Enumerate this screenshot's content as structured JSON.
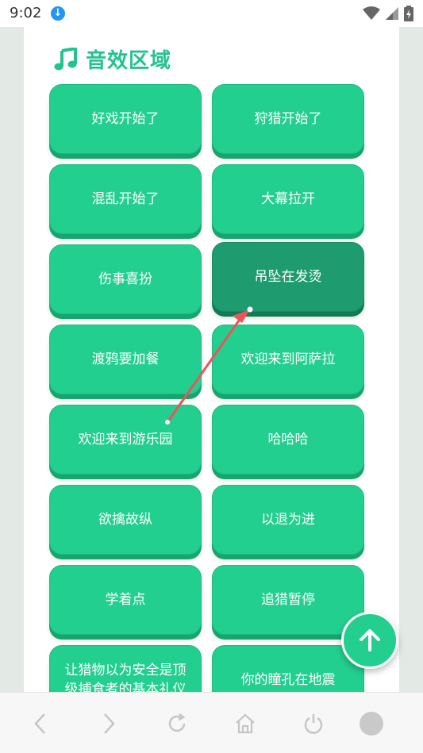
{
  "status": {
    "time": "9:02"
  },
  "section": {
    "title": "音效区域"
  },
  "buttons": [
    {
      "label": "好戏开始了"
    },
    {
      "label": "狩猎开始了"
    },
    {
      "label": "混乱开始了"
    },
    {
      "label": "大幕拉开"
    },
    {
      "label": "伤事喜扮"
    },
    {
      "label": "吊坠在发烫",
      "pressed": true
    },
    {
      "label": "渡鸦要加餐"
    },
    {
      "label": "欢迎来到阿萨拉"
    },
    {
      "label": "欢迎来到游乐园"
    },
    {
      "label": "哈哈哈"
    },
    {
      "label": "欲擒故纵"
    },
    {
      "label": "以退为进"
    },
    {
      "label": "学着点"
    },
    {
      "label": "追猎暂停"
    },
    {
      "label": "让猎物以为安全是顶级捕食者的基本礼仪"
    },
    {
      "label": "你的瞳孔在地震"
    }
  ],
  "colors": {
    "accent": "#22cf8f",
    "accent_dark": "#17a46f",
    "pressed": "#1e9c70",
    "arrow": "#e8555a"
  },
  "icons": {
    "title_icon": "music-note-icon",
    "fab": "arrow-up-icon",
    "nav": [
      "back-icon",
      "forward-icon",
      "refresh-icon",
      "home-icon",
      "power-icon",
      "record-icon"
    ]
  }
}
